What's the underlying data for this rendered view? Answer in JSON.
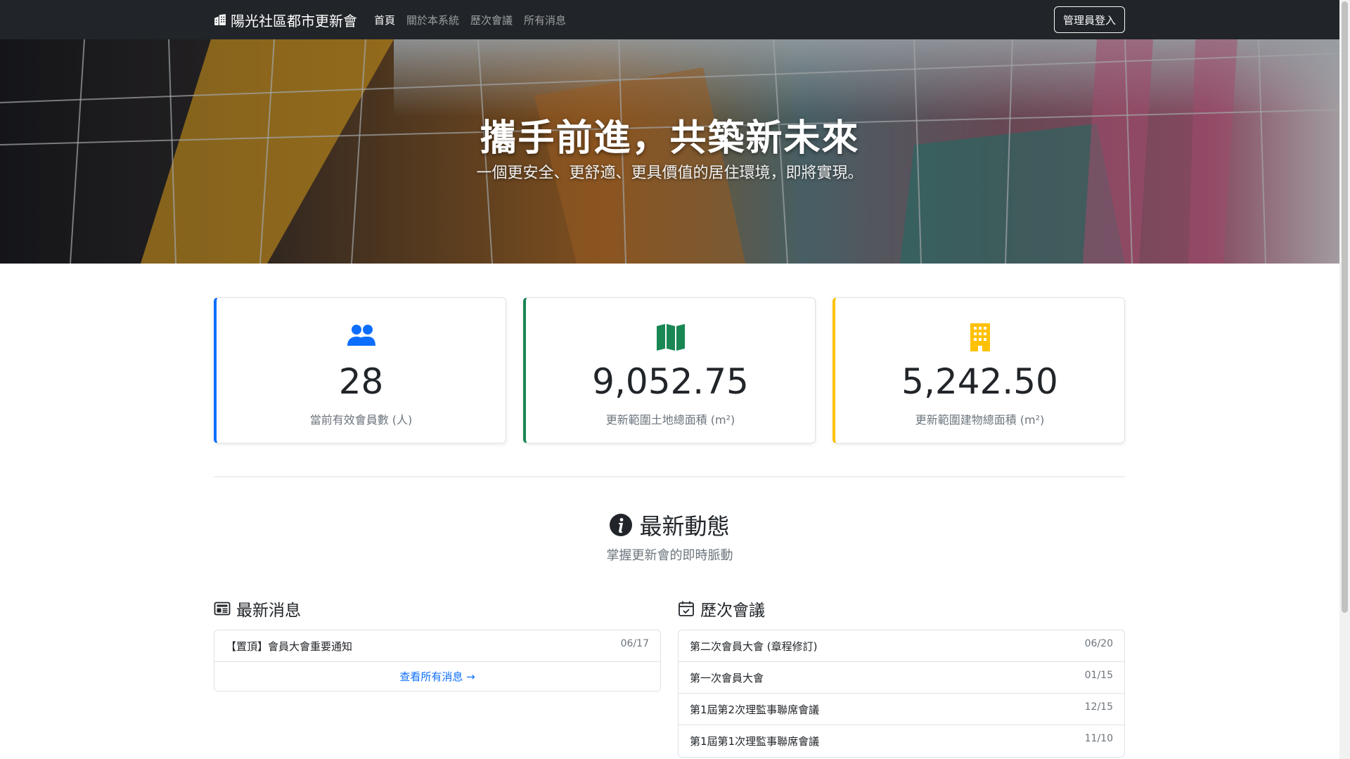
{
  "navbar": {
    "brand": "陽光社區都市更新會",
    "links": [
      {
        "label": "首頁",
        "active": true
      },
      {
        "label": "關於本系統",
        "active": false
      },
      {
        "label": "歷次會議",
        "active": false
      },
      {
        "label": "所有消息",
        "active": false
      }
    ],
    "admin_login": "管理員登入"
  },
  "hero": {
    "title": "攜手前進，共築新未來",
    "subtitle": "一個更安全、更舒適、更具價值的居住環境，即將實現。"
  },
  "stats": [
    {
      "icon": "people-icon",
      "color": "#0d6efd",
      "value": "28",
      "label": "當前有效會員數 (人)"
    },
    {
      "icon": "map-icon",
      "color": "#198754",
      "value": "9,052.75",
      "label": "更新範圍土地總面積 (m²)"
    },
    {
      "icon": "building-icon",
      "color": "#ffc107",
      "value": "5,242.50",
      "label": "更新範圍建物總面積 (m²)"
    }
  ],
  "section": {
    "title": "最新動態",
    "subtitle": "掌握更新會的即時脈動"
  },
  "news": {
    "title": "最新消息",
    "items": [
      {
        "title": "【置頂】會員大會重要通知",
        "date": "06/17"
      }
    ],
    "more": "查看所有消息 →"
  },
  "meetings": {
    "title": "歷次會議",
    "items": [
      {
        "title": "第二次會員大會 (章程修訂)",
        "date": "06/20"
      },
      {
        "title": "第一次會員大會",
        "date": "01/15"
      },
      {
        "title": "第1屆第2次理監事聯席會議",
        "date": "12/15"
      },
      {
        "title": "第1屆第1次理監事聯席會議",
        "date": "11/10"
      }
    ]
  }
}
